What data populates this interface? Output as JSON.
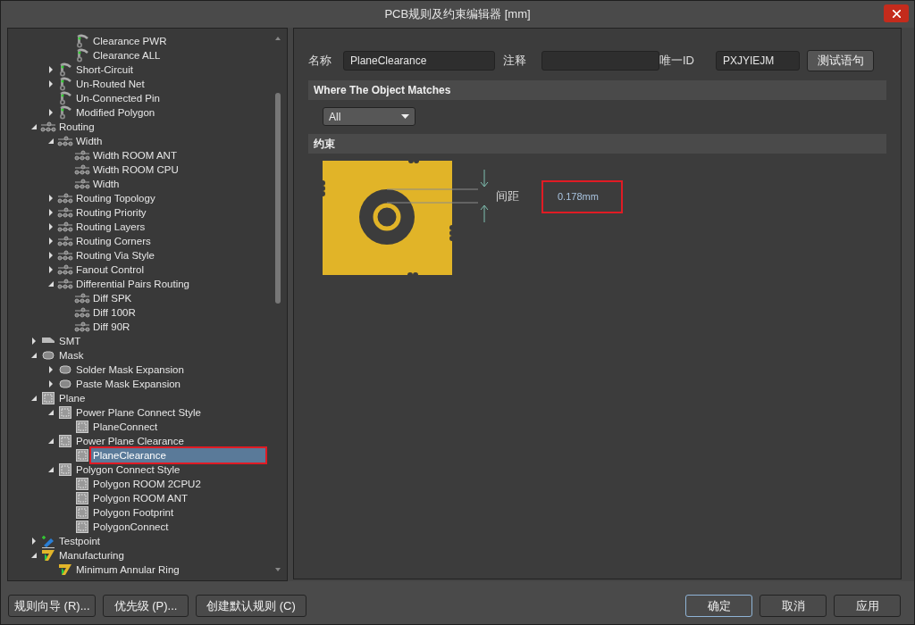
{
  "window": {
    "title": "PCB规则及约束编辑器 [mm]"
  },
  "rule_tree": {
    "items": [
      {
        "children": [
          {
            "children": [
              {
                "label": "Clearance PWR",
                "kind": "electrical",
                "selected": false
              },
              {
                "label": "Clearance ALL",
                "kind": "electrical",
                "selected": false
              }
            ]
          },
          {
            "label": "Short-Circuit",
            "kind": "electrical",
            "expanded": false,
            "selected": false
          },
          {
            "label": "Un-Routed Net",
            "kind": "electrical",
            "expanded": false,
            "selected": false
          },
          {
            "label": "Un-Connected Pin",
            "kind": "electrical",
            "selected": false
          },
          {
            "label": "Modified Polygon",
            "kind": "electrical",
            "expanded": false,
            "selected": false
          }
        ]
      },
      {
        "label": "Routing",
        "kind": "routing",
        "expanded": true,
        "selected": false,
        "children": [
          {
            "label": "Width",
            "kind": "routing",
            "expanded": true,
            "selected": false,
            "children": [
              {
                "label": "Width ROOM ANT",
                "kind": "routing",
                "selected": false
              },
              {
                "label": "Width ROOM CPU",
                "kind": "routing",
                "selected": false
              },
              {
                "label": "Width",
                "kind": "routing",
                "selected": false
              }
            ]
          },
          {
            "label": "Routing Topology",
            "kind": "routing",
            "expanded": false,
            "selected": false
          },
          {
            "label": "Routing Priority",
            "kind": "routing",
            "expanded": false,
            "selected": false
          },
          {
            "label": "Routing Layers",
            "kind": "routing",
            "expanded": false,
            "selected": false
          },
          {
            "label": "Routing Corners",
            "kind": "routing",
            "expanded": false,
            "selected": false
          },
          {
            "label": "Routing Via Style",
            "kind": "routing",
            "expanded": false,
            "selected": false
          },
          {
            "label": "Fanout Control",
            "kind": "routing",
            "expanded": false,
            "selected": false
          },
          {
            "label": "Differential Pairs Routing",
            "kind": "routing",
            "expanded": true,
            "selected": false,
            "children": [
              {
                "label": "Diff SPK",
                "kind": "routing",
                "selected": false
              },
              {
                "label": "Diff 100R",
                "kind": "routing",
                "selected": false
              },
              {
                "label": "Diff 90R",
                "kind": "routing",
                "selected": false
              }
            ]
          }
        ]
      },
      {
        "label": "SMT",
        "kind": "smt",
        "expanded": false,
        "selected": false
      },
      {
        "label": "Mask",
        "kind": "mask",
        "expanded": true,
        "selected": false,
        "children": [
          {
            "label": "Solder Mask Expansion",
            "kind": "mask",
            "expanded": false,
            "selected": false
          },
          {
            "label": "Paste Mask Expansion",
            "kind": "mask",
            "expanded": false,
            "selected": false
          }
        ]
      },
      {
        "label": "Plane",
        "kind": "plane",
        "expanded": true,
        "selected": false,
        "children": [
          {
            "label": "Power Plane Connect Style",
            "kind": "plane",
            "expanded": true,
            "selected": false,
            "children": [
              {
                "label": "PlaneConnect",
                "kind": "plane",
                "selected": false
              }
            ]
          },
          {
            "label": "Power Plane Clearance",
            "kind": "plane",
            "expanded": true,
            "selected": false,
            "children": [
              {
                "label": "PlaneClearance",
                "kind": "plane",
                "selected": true,
                "highlighted": true
              }
            ]
          },
          {
            "label": "Polygon Connect Style",
            "kind": "plane",
            "expanded": true,
            "selected": false,
            "children": [
              {
                "label": "Polygon ROOM 2CPU2",
                "kind": "plane",
                "selected": false
              },
              {
                "label": "Polygon ROOM ANT",
                "kind": "plane",
                "selected": false
              },
              {
                "label": "Polygon Footprint",
                "kind": "plane",
                "selected": false
              },
              {
                "label": "PolygonConnect",
                "kind": "plane",
                "selected": false
              }
            ]
          }
        ]
      },
      {
        "label": "Testpoint",
        "kind": "testpoint",
        "expanded": false,
        "selected": false
      },
      {
        "label": "Manufacturing",
        "kind": "manufacturing",
        "expanded": true,
        "selected": false,
        "children": [
          {
            "label": "Minimum Annular Ring",
            "kind": "manufacturing",
            "selected": false
          }
        ]
      }
    ]
  },
  "editor": {
    "name_label": "名称",
    "name_value": "PlaneClearance",
    "comment_label": "注释",
    "id_label": "唯一ID",
    "id_value": "PXJYIEJM",
    "test_button": "测试语句",
    "match_section": "Where The Object Matches",
    "match_dropdown": "All",
    "constraint_section": "约束",
    "clearance_label": "间距",
    "clearance_value": "0.178mm",
    "clearance_highlighted": true
  },
  "left_buttons": [
    "规则向导 (R)...",
    "优先级 (P)...",
    "创建默认规则 (C)"
  ],
  "right_buttons": [
    {
      "label": "确定",
      "default": true
    },
    {
      "label": "取消",
      "default": false
    },
    {
      "label": "应用",
      "default": false
    }
  ]
}
